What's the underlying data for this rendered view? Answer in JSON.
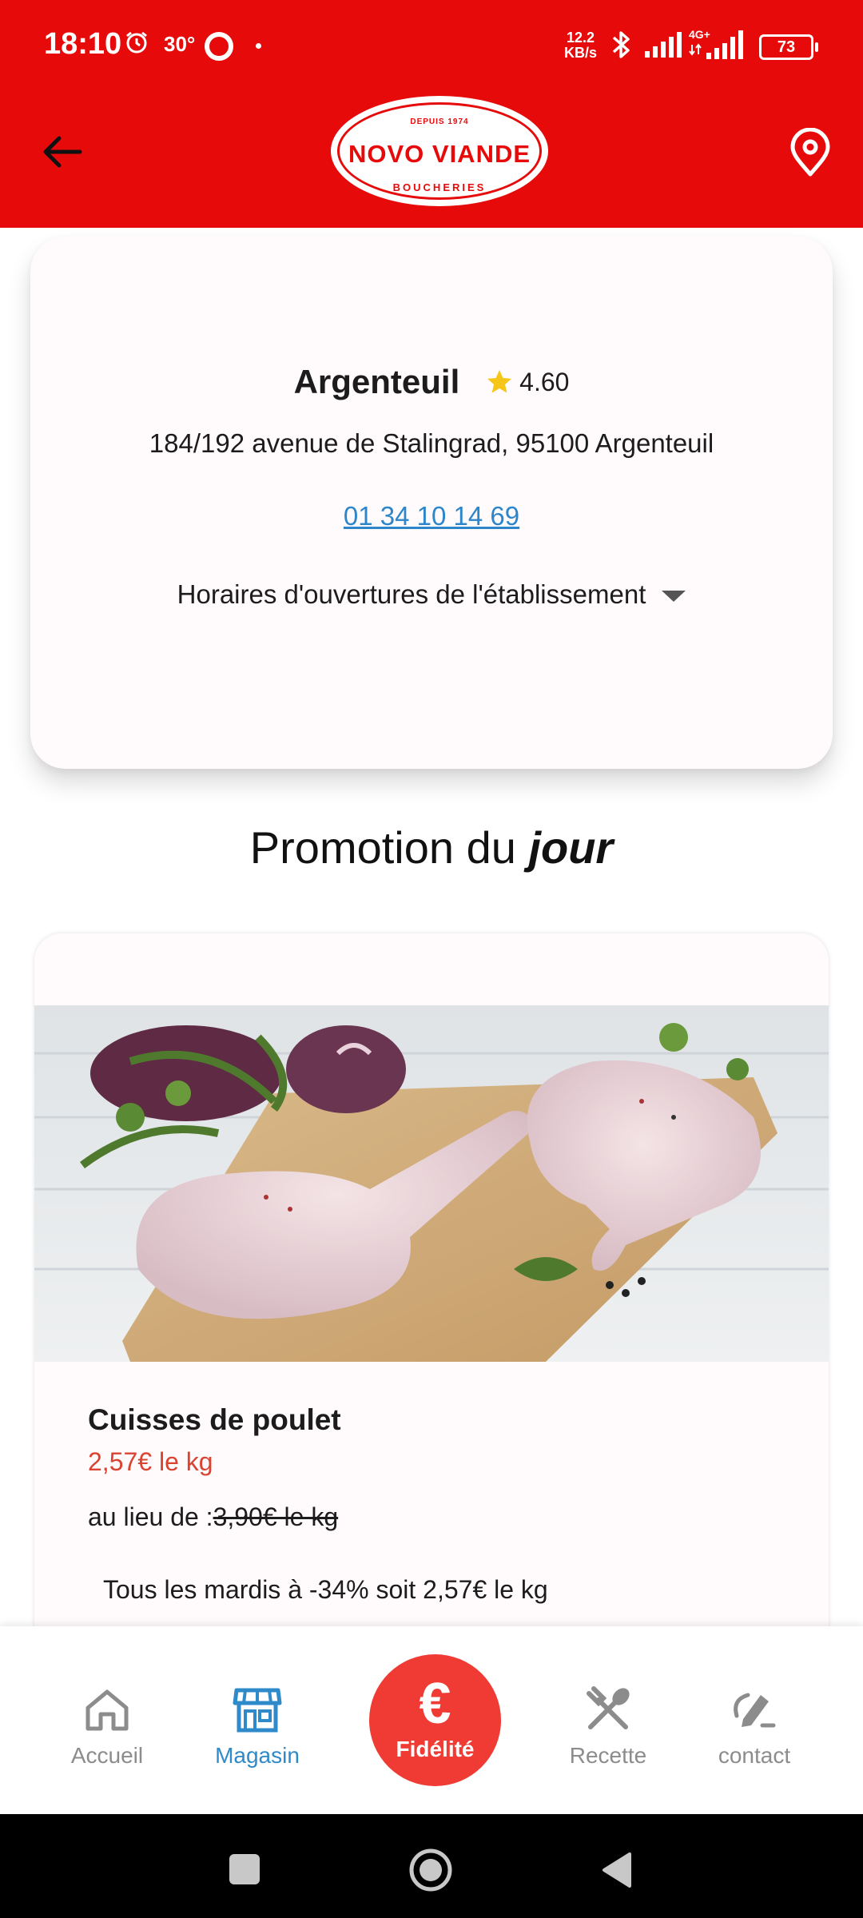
{
  "status_bar": {
    "time": "18:10",
    "temperature": "30°",
    "network_speed_value": "12.2",
    "network_speed_unit": "KB/s",
    "network_type": "4G+",
    "battery": "73"
  },
  "header": {
    "logo_top": "DEPUIS 1974",
    "logo_brand": "NOVO VIANDE",
    "logo_sub": "BOUCHERIES"
  },
  "store": {
    "name": "Argenteuil",
    "rating": "4.60",
    "address": "184/192 avenue de Stalingrad, 95100 Argenteuil",
    "phone": "01 34 10 14 69",
    "hours_label": "Horaires d'ouvertures de l'établissement"
  },
  "promo": {
    "heading_prefix": "Promotion du ",
    "heading_emphasis": "jour",
    "product_name": "Cuisses de poulet",
    "price": "2,57€ le kg",
    "old_prefix": "au lieu de :",
    "old_price": "3,90€ le kg",
    "description": "Tous les mardis à -34% soit 2,57€ le kg"
  },
  "bottom_nav": {
    "items": [
      {
        "label": "Accueil",
        "icon": "home-icon"
      },
      {
        "label": "Magasin",
        "icon": "store-icon"
      },
      {
        "label": "Recette",
        "icon": "utensils-icon"
      },
      {
        "label": "contact",
        "icon": "edit-icon"
      }
    ],
    "fab_symbol": "€",
    "fab_label": "Fidélité",
    "active_color": "#2e8ac8",
    "inactive_color": "#8c8c8c"
  },
  "colors": {
    "brand_red": "#e60a0a",
    "price_red": "#d9432f",
    "link_blue": "#2d86c9",
    "star_yellow": "#f5c518"
  }
}
